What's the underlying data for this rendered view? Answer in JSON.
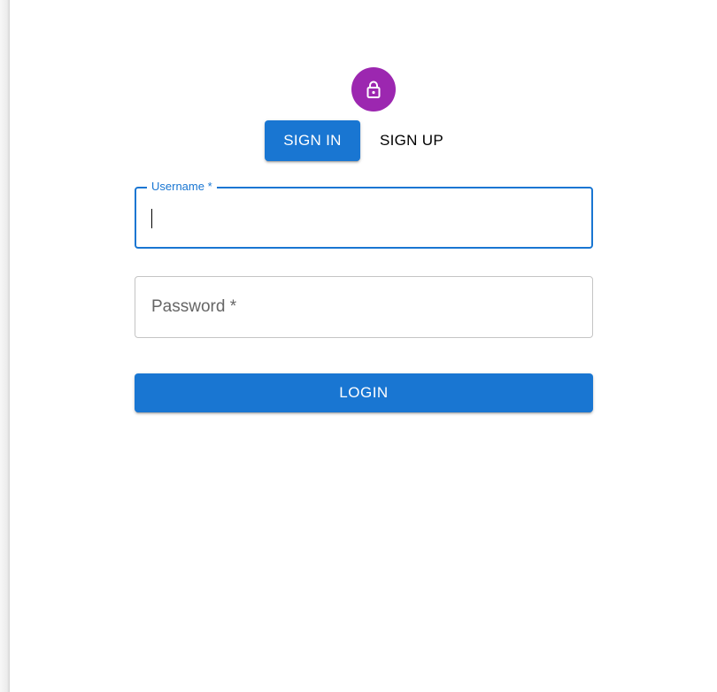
{
  "header": {
    "avatar_icon": "lock-icon",
    "avatar_color": "#9c27b0"
  },
  "tabs": {
    "sign_in": "SIGN IN",
    "sign_up": "SIGN UP",
    "active": "sign_in"
  },
  "form": {
    "username": {
      "label": "Username *",
      "value": "",
      "focused": true
    },
    "password": {
      "label": "Password *",
      "value": ""
    },
    "submit_label": "LOGIN"
  },
  "colors": {
    "primary": "#1976d2",
    "input_border": "#c4c4c4"
  }
}
